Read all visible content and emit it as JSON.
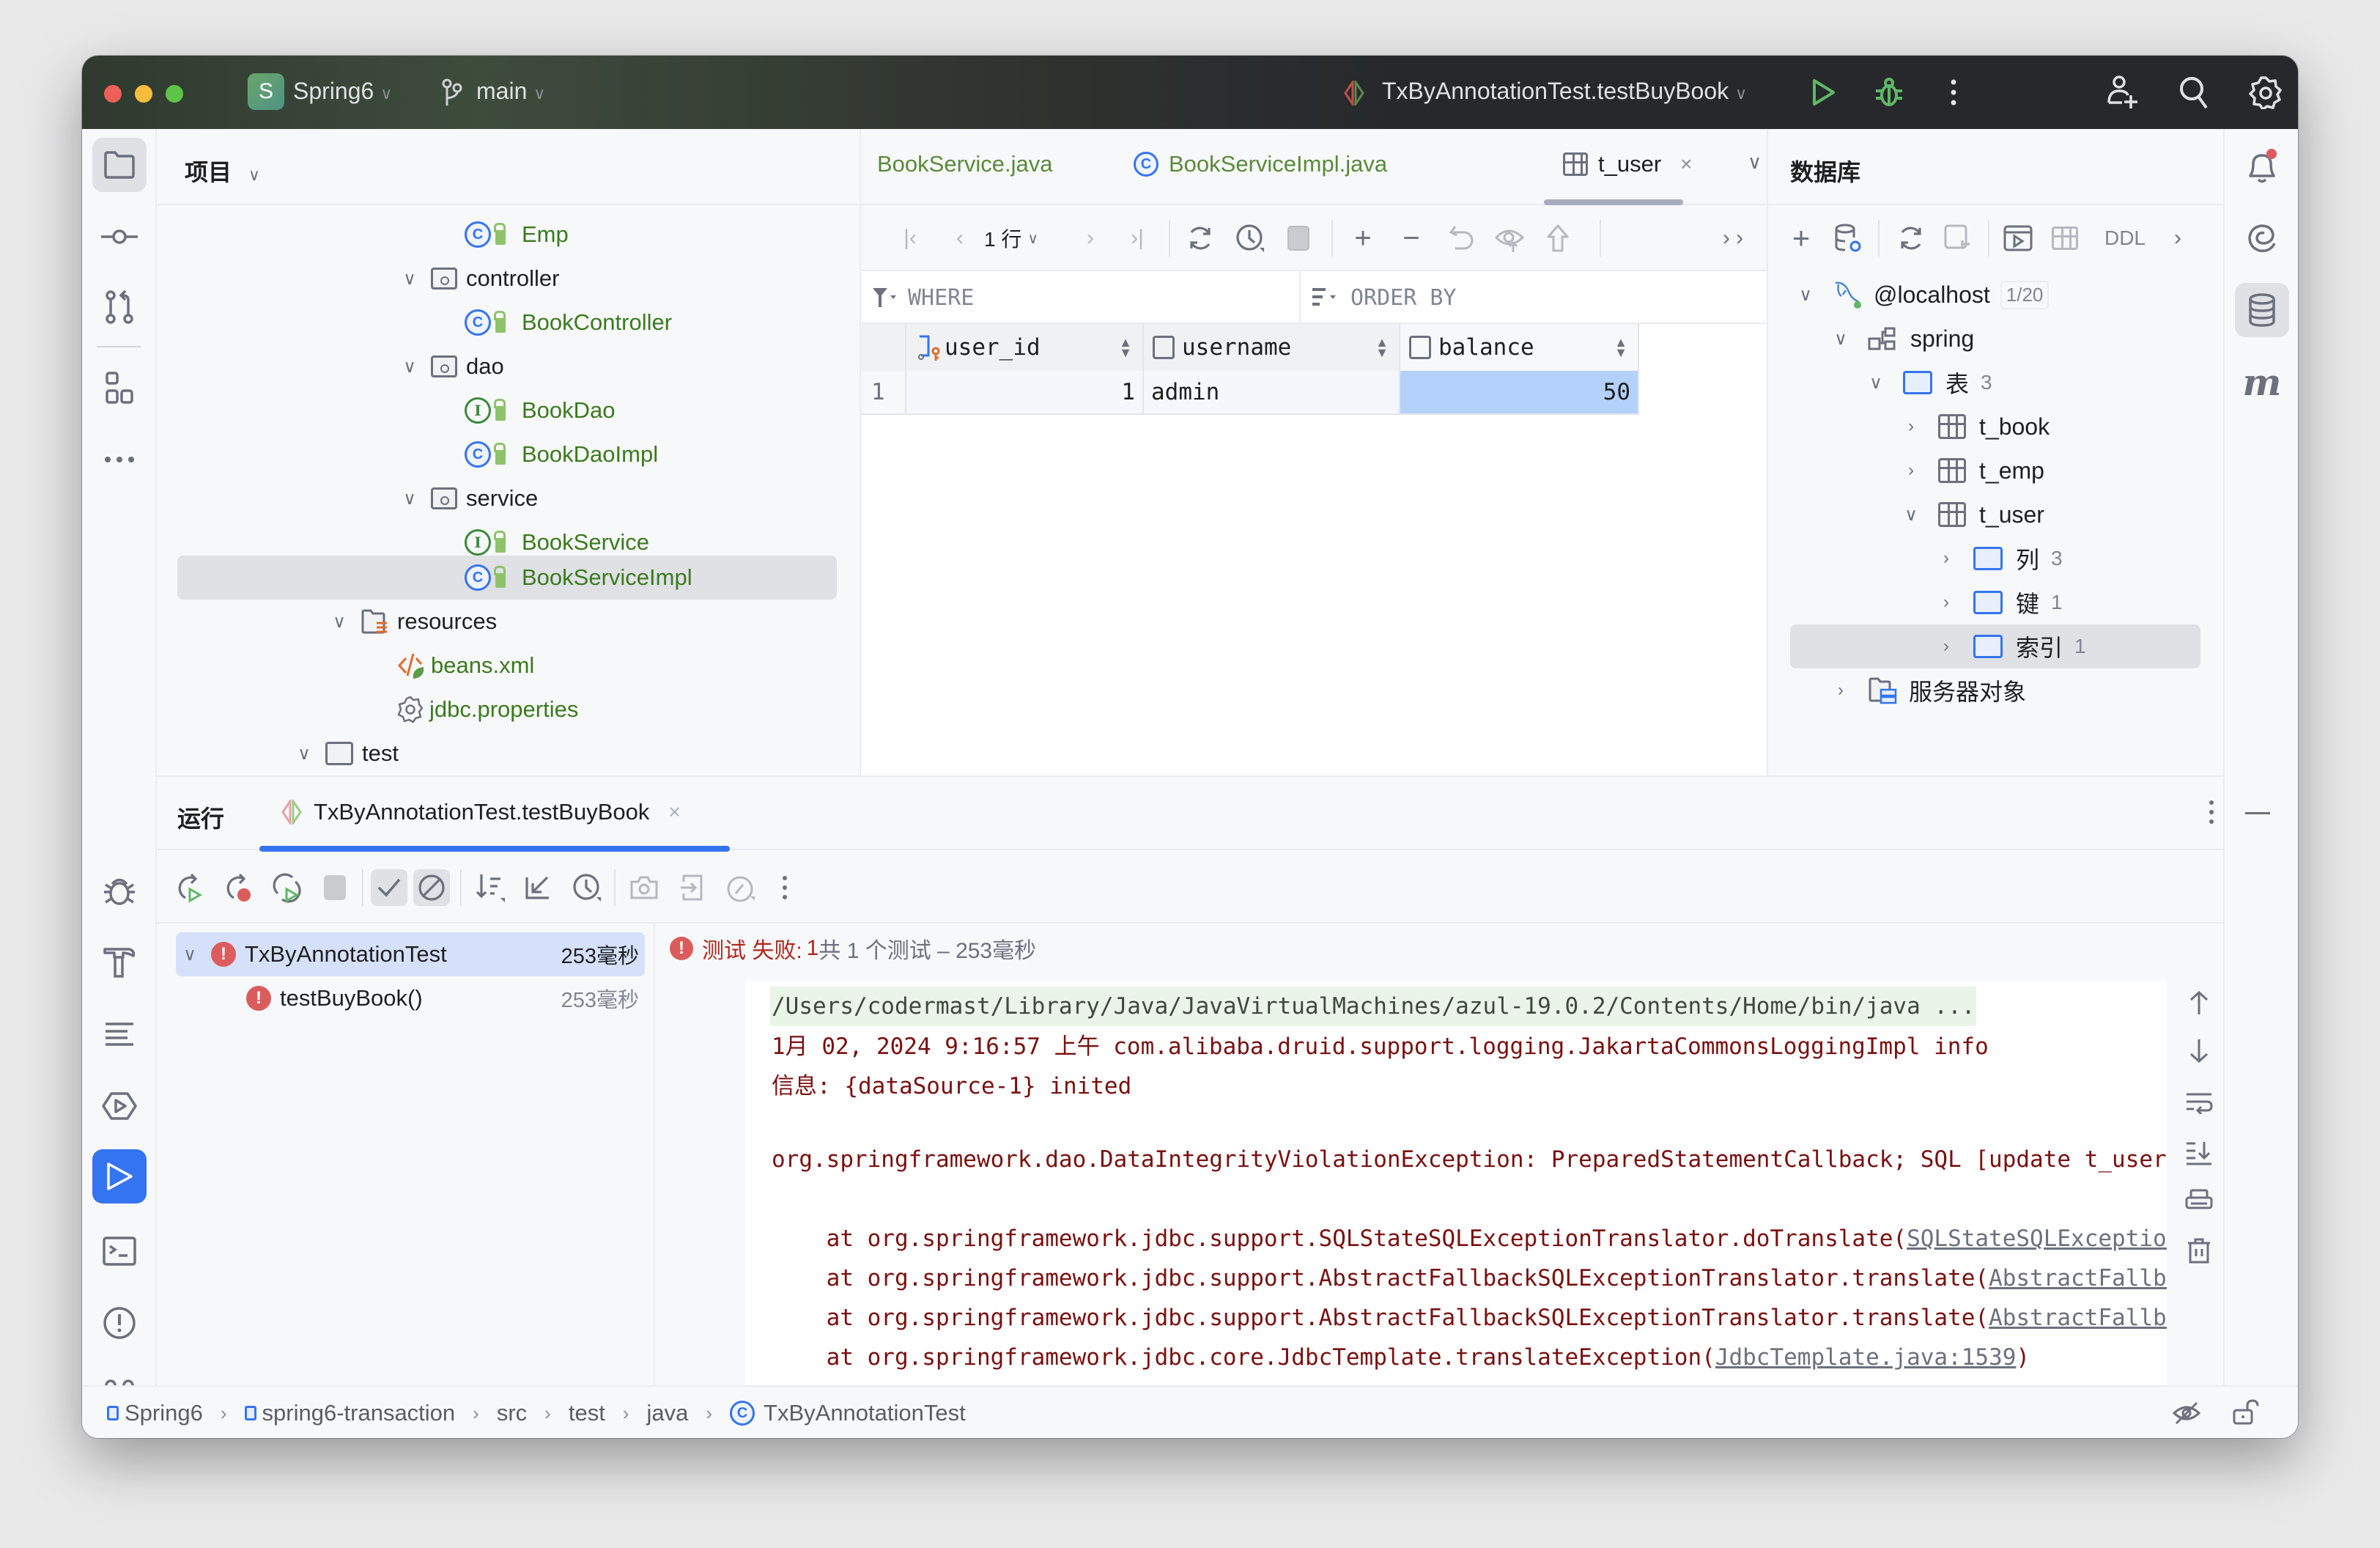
{
  "titlebar": {
    "project_badge": "S",
    "project_name": "Spring6",
    "branch": "main",
    "run_config": "TxByAnnotationTest.testBuyBook",
    "icons": [
      "run-icon",
      "debug-icon",
      "more-icon",
      "add-user-icon",
      "search-icon",
      "settings-icon"
    ]
  },
  "left_strip": {
    "top_icons": [
      "project-folder-icon",
      "commit-icon",
      "pull-request-icon",
      "structure-icon",
      "more-tools-icon"
    ],
    "bottom_icons": [
      "debug-icon",
      "build-icon",
      "todo-icon",
      "services-icon",
      "run-icon",
      "terminal-icon",
      "problems-icon",
      "git-icon"
    ]
  },
  "project_panel": {
    "title": "项目",
    "tree": [
      {
        "label": "Emp",
        "kind": "class",
        "depth": 4
      },
      {
        "label": "controller",
        "kind": "package",
        "depth": 3,
        "expanded": true
      },
      {
        "label": "BookController",
        "kind": "class",
        "depth": 4
      },
      {
        "label": "dao",
        "kind": "package",
        "depth": 3,
        "expanded": true
      },
      {
        "label": "BookDao",
        "kind": "interface",
        "depth": 4
      },
      {
        "label": "BookDaoImpl",
        "kind": "class",
        "depth": 4
      },
      {
        "label": "service",
        "kind": "package",
        "depth": 3,
        "expanded": true
      },
      {
        "label": "BookService",
        "kind": "interface",
        "depth": 4
      },
      {
        "label": "BookServiceImpl",
        "kind": "class",
        "depth": 4,
        "selected": true
      },
      {
        "label": "resources",
        "kind": "resources",
        "depth": 2,
        "expanded": true
      },
      {
        "label": "beans.xml",
        "kind": "xml",
        "depth": 3
      },
      {
        "label": "jdbc.properties",
        "kind": "properties",
        "depth": 3
      },
      {
        "label": "test",
        "kind": "folder",
        "depth": 1,
        "expanded": true
      }
    ]
  },
  "editor": {
    "tabs": [
      {
        "label": "BookService.java",
        "active": false
      },
      {
        "label": "BookServiceImpl.java",
        "active": false
      },
      {
        "label": "t_user",
        "active": true
      }
    ],
    "toolbar": {
      "row_count": "1 行",
      "icons": [
        "first-page-icon",
        "prev-page-icon",
        "next-page-icon",
        "last-page-icon",
        "reload-icon",
        "history-icon",
        "stop-icon",
        "add-row-icon",
        "delete-row-icon",
        "revert-icon",
        "preview-icon",
        "submit-icon",
        "more-icon"
      ]
    },
    "filter": {
      "where_placeholder": "WHERE",
      "order_placeholder": "ORDER BY"
    },
    "grid": {
      "columns": [
        {
          "name": "user_id",
          "key": true
        },
        {
          "name": "username",
          "key": false
        },
        {
          "name": "balance",
          "key": false
        }
      ],
      "rows": [
        {
          "row_number": "1",
          "cells": [
            "1",
            "admin",
            "50"
          ]
        }
      ]
    }
  },
  "database_panel": {
    "title": "数据库",
    "toolbar": {
      "ddl_label": "DDL"
    },
    "tree": [
      {
        "label": "@localhost",
        "badge": "1/20",
        "kind": "connection",
        "depth": 0,
        "expanded": true
      },
      {
        "label": "spring",
        "kind": "schema",
        "depth": 1,
        "expanded": true
      },
      {
        "label": "表",
        "count": "3",
        "kind": "folder",
        "depth": 2,
        "expanded": true
      },
      {
        "label": "t_book",
        "kind": "table",
        "depth": 3,
        "expanded": false
      },
      {
        "label": "t_emp",
        "kind": "table",
        "depth": 3,
        "expanded": false
      },
      {
        "label": "t_user",
        "kind": "table",
        "depth": 3,
        "expanded": true
      },
      {
        "label": "列",
        "count": "3",
        "kind": "folder",
        "depth": 4,
        "expanded": false
      },
      {
        "label": "键",
        "count": "1",
        "kind": "folder",
        "depth": 4,
        "expanded": false
      },
      {
        "label": "索引",
        "count": "1",
        "kind": "folder",
        "depth": 4,
        "expanded": false,
        "selected": true
      },
      {
        "label": "服务器对象",
        "kind": "server-objects",
        "depth": 1,
        "expanded": false
      }
    ]
  },
  "right_strip": {
    "icons": [
      "notifications-icon",
      "ai-assistant-icon",
      "database-icon",
      "maven-icon"
    ]
  },
  "run_panel": {
    "title": "运行",
    "tab_label": "TxByAnnotationTest.testBuyBook",
    "toolbar_icons": [
      "rerun-icon",
      "rerun-failed-icon",
      "toggle-auto-test-icon",
      "stop-icon",
      "show-passed-icon",
      "show-ignored-icon",
      "sort-icon",
      "collapse-icon",
      "sort-by-duration-icon",
      "screenshot-icon",
      "import-icon",
      "coverage-icon",
      "more-icon"
    ],
    "tests": [
      {
        "name": "TxByAnnotationTest",
        "duration": "253毫秒",
        "status": "failed",
        "selected": true
      },
      {
        "name": "testBuyBook()",
        "duration": "253毫秒",
        "status": "failed"
      }
    ],
    "summary": {
      "failed_label": "测试 失败:",
      "failed_count": "1",
      "rest": "共 1 个测试 – 253毫秒"
    },
    "console": {
      "command_line": "/Users/codermast/Library/Java/JavaVirtualMachines/azul-19.0.2/Contents/Home/bin/java ...",
      "lines": [
        {
          "text": "1月 02, 2024 9:16:57 上午 com.alibaba.druid.support.logging.JakartaCommonsLoggingImpl info"
        },
        {
          "text": "信息: {dataSource-1} inited"
        },
        {
          "text": ""
        },
        {
          "text": "org.springframework.dao.DataIntegrityViolationException: PreparedStatementCallback; SQL [update t_user s"
        },
        {
          "text": ""
        },
        {
          "text": "    at org.springframework.jdbc.support.SQLStateSQLExceptionTranslator.doTranslate(",
          "link": "SQLStateSQLExceptionT"
        },
        {
          "text": "    at org.springframework.jdbc.support.AbstractFallbackSQLExceptionTranslator.translate(",
          "link": "AbstractFallbac"
        },
        {
          "text": "    at org.springframework.jdbc.support.AbstractFallbackSQLExceptionTranslator.translate(",
          "link": "AbstractFallbac"
        },
        {
          "text": "    at org.springframework.jdbc.core.JdbcTemplate.translateException(",
          "link": "JdbcTemplate.java:1539",
          "suffix": ")"
        }
      ],
      "side_icons": [
        "scroll-up-icon",
        "scroll-down-icon",
        "soft-wrap-icon",
        "scroll-to-end-icon",
        "print-icon",
        "clear-icon"
      ]
    }
  },
  "statusbar": {
    "breadcrumbs": [
      "Spring6",
      "spring6-transaction",
      "src",
      "test",
      "java",
      "TxByAnnotationTest"
    ],
    "right_icons": [
      "no-inspections-icon",
      "read-only-lock-icon"
    ]
  },
  "colors": {
    "accent": "#3574f0",
    "error": "#db5c5c",
    "console_error_text": "#7a1010",
    "green_file": "#3b7a1e",
    "selected_cell": "#b3d1fc"
  }
}
